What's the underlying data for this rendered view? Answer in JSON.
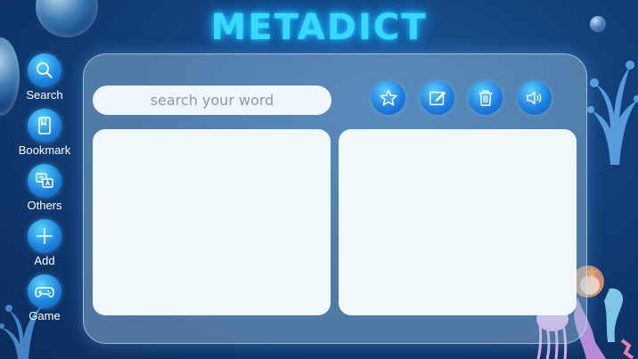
{
  "app": {
    "title": "METADICT"
  },
  "search": {
    "placeholder": "search your word",
    "value": ""
  },
  "toolbar": {
    "items": [
      {
        "icon": "star-icon"
      },
      {
        "icon": "edit-icon"
      },
      {
        "icon": "trash-icon"
      },
      {
        "icon": "speaker-icon"
      }
    ]
  },
  "sidebar": {
    "items": [
      {
        "label": "Search",
        "icon": "search-icon"
      },
      {
        "label": "Bookmark",
        "icon": "bookmark-icon"
      },
      {
        "label": "Others",
        "icon": "translate-icon"
      },
      {
        "label": "Add",
        "icon": "plus-icon"
      },
      {
        "label": "Game",
        "icon": "gamepad-icon"
      }
    ]
  },
  "colors": {
    "accent": "#38d9ff",
    "background": "#123f78",
    "panel": "#eff8fb",
    "button": "#1f7fe0"
  }
}
